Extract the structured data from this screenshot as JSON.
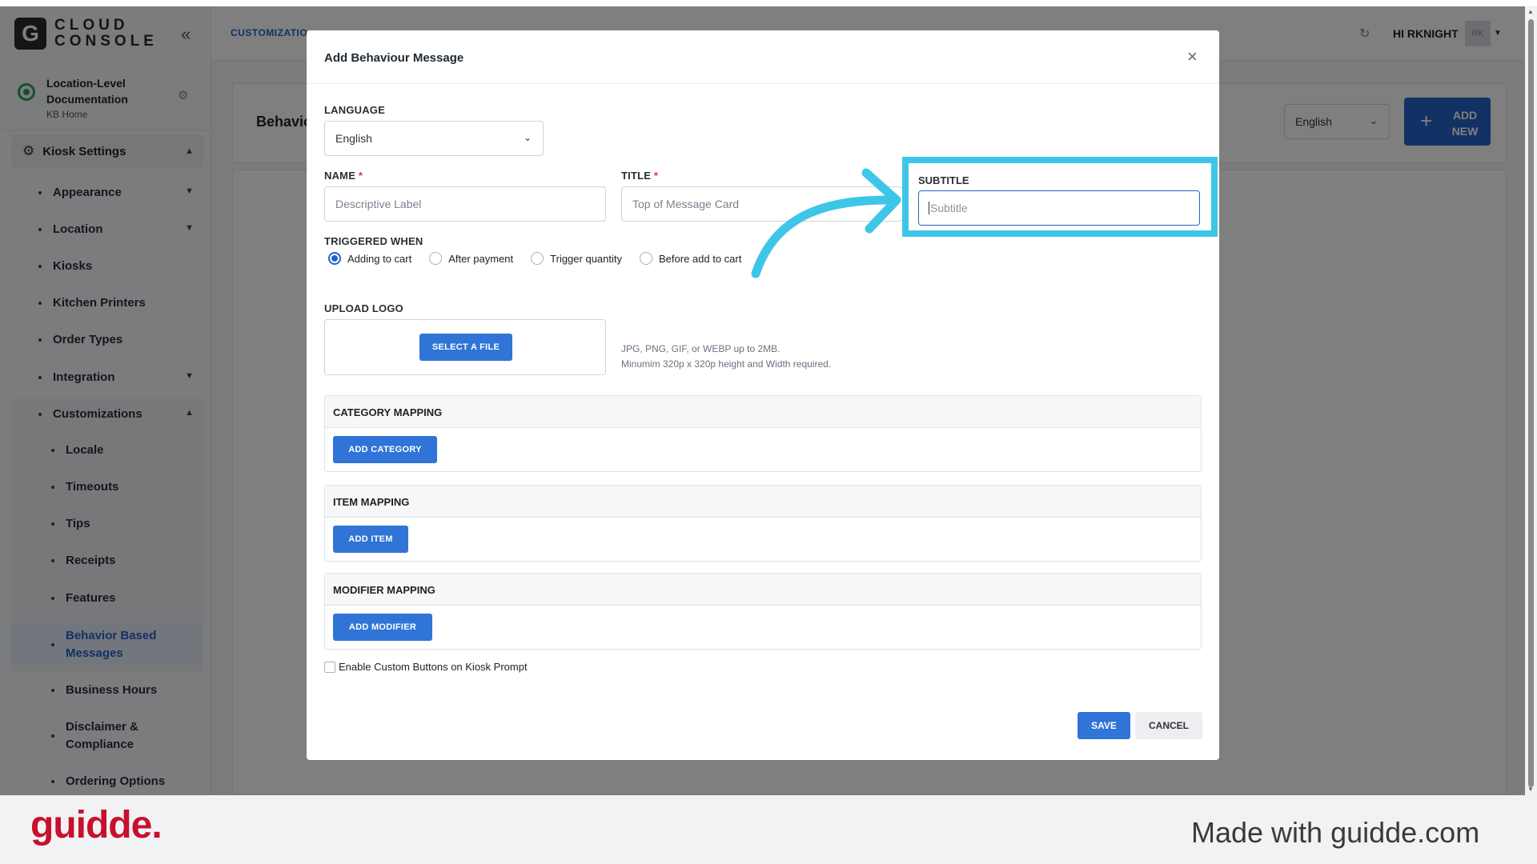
{
  "app": {
    "logo_letter": "G",
    "logo_text": "CLOUD\nCONSOLE",
    "location_name": "Location-Level Documentation",
    "location_sub": "KB Home",
    "breadcrumb": "CUSTOMIZATIO",
    "greeting": "HI RKNIGHT",
    "avatar_initials": "RK",
    "page_title": "Behavio",
    "language_select": "English",
    "add_new_label": "ADD NEW"
  },
  "sidebar": {
    "section": "Kiosk Settings",
    "items": [
      {
        "label": "Appearance",
        "chevron": true
      },
      {
        "label": "Location",
        "chevron": true
      },
      {
        "label": "Kiosks",
        "chevron": false
      },
      {
        "label": "Kitchen Printers",
        "chevron": false
      },
      {
        "label": "Order Types",
        "chevron": false
      },
      {
        "label": "Integration",
        "chevron": true
      },
      {
        "label": "Customizations",
        "chevron": true
      }
    ],
    "subitems": [
      "Locale",
      "Timeouts",
      "Tips",
      "Receipts",
      "Features",
      "Behavior Based Messages",
      "Business Hours",
      "Disclaimer & Compliance",
      "Ordering Options"
    ]
  },
  "modal": {
    "title": "Add Behaviour Message",
    "close_icon": "×",
    "language_label": "LANGUAGE",
    "language_value": "English",
    "name_label": "NAME",
    "name_placeholder": "Descriptive Label",
    "title_label": "TITLE",
    "title_placeholder": "Top of Message Card",
    "subtitle_label": "SUBTITLE",
    "subtitle_placeholder": "Subtitle",
    "triggered_label": "TRIGGERED WHEN",
    "triggers": [
      {
        "label": "Adding to cart",
        "selected": true
      },
      {
        "label": "After payment",
        "selected": false
      },
      {
        "label": "Trigger quantity",
        "selected": false
      },
      {
        "label": "Before add to cart",
        "selected": false
      }
    ],
    "upload_label": "UPLOAD LOGO",
    "select_file": "SELECT A FILE",
    "hint_line1": "JPG, PNG, GIF, or WEBP up to 2MB.",
    "hint_line2": "Minumim 320p x 320p height and Width required.",
    "category_mapping": "CATEGORY MAPPING",
    "add_category": "ADD CATEGORY",
    "item_mapping": "ITEM MAPPING",
    "add_item": "ADD ITEM",
    "modifier_mapping": "MODIFIER MAPPING",
    "add_modifier": "ADD MODIFIER",
    "custom_buttons": "Enable Custom Buttons on Kiosk Prompt",
    "save": "SAVE",
    "cancel": "CANCEL"
  },
  "footer": {
    "brand": "guidde.",
    "made_with": "Made with guidde.com"
  },
  "colors": {
    "accent": "#2563c9",
    "highlight": "#3ec6e8",
    "brand": "#c8102e"
  }
}
